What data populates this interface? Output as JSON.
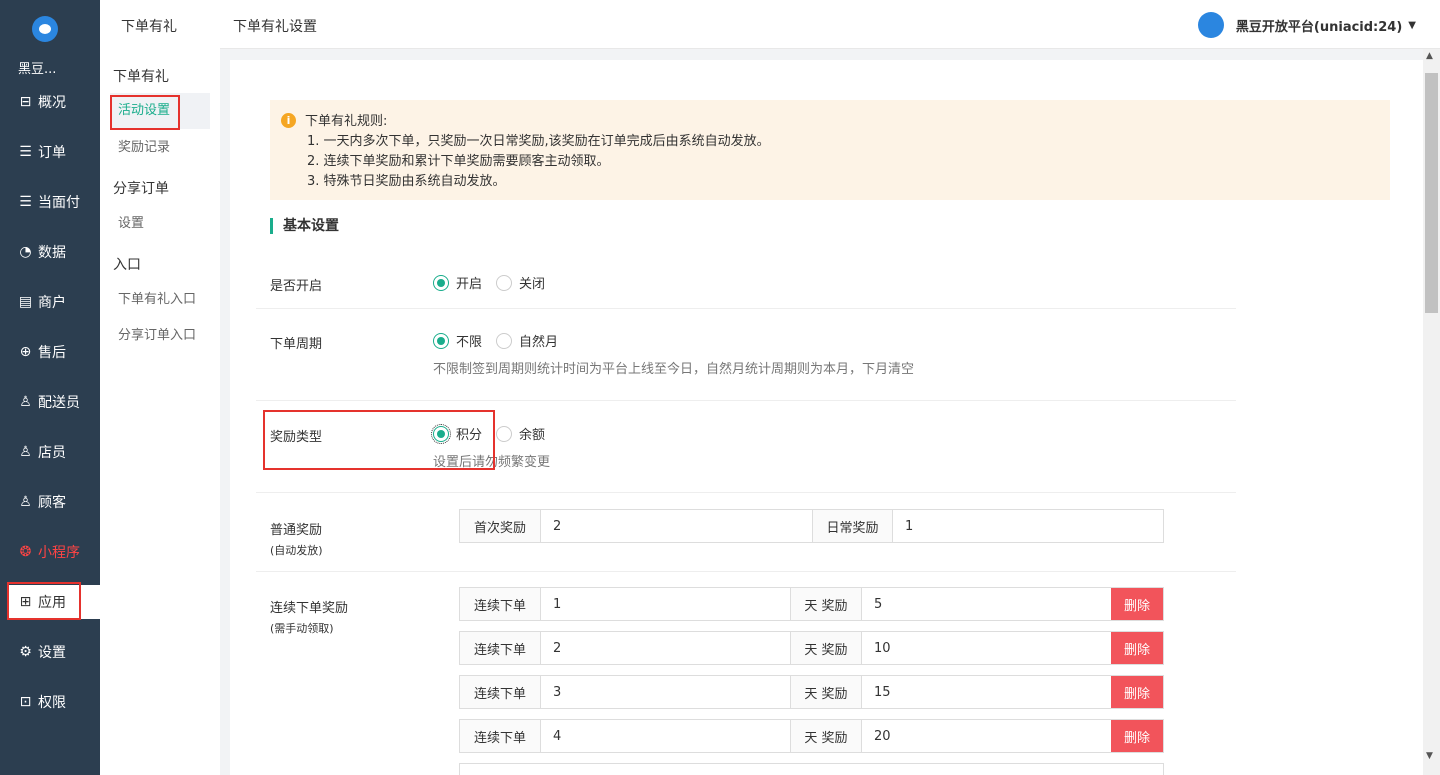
{
  "nav": {
    "brand": "黑豆...",
    "items": [
      {
        "label": "概况",
        "icon": "overview-icon"
      },
      {
        "label": "订单",
        "icon": "order-icon"
      },
      {
        "label": "当面付",
        "icon": "pay-icon"
      },
      {
        "label": "数据",
        "icon": "chart-icon"
      },
      {
        "label": "商户",
        "icon": "shop-icon"
      },
      {
        "label": "售后",
        "icon": "aftersale-icon"
      },
      {
        "label": "配送员",
        "icon": "courier-icon"
      },
      {
        "label": "店员",
        "icon": "staff-icon"
      },
      {
        "label": "顾客",
        "icon": "customer-icon"
      },
      {
        "label": "小程序",
        "icon": "miniprogram-icon"
      },
      {
        "label": "应用",
        "icon": "apps-icon"
      },
      {
        "label": "设置",
        "icon": "gear-icon"
      },
      {
        "label": "权限",
        "icon": "lock-icon"
      }
    ]
  },
  "sub": {
    "group1": "下单有礼",
    "item_active": "活动设置",
    "item2": "奖励记录",
    "group2": "分享订单",
    "item3": "设置",
    "group3": "入口",
    "item4": "下单有礼入口",
    "item5": "分享订单入口"
  },
  "topbar": {
    "section": "下单有礼",
    "title": "下单有礼设置",
    "user": "黑豆开放平台(uniacid:24)"
  },
  "notice": {
    "title": "下单有礼规则:",
    "rules": [
      "1. 一天内多次下单，只奖励一次日常奖励,该奖励在订单完成后由系统自动发放。",
      "2. 连续下单奖励和累计下单奖励需要顾客主动领取。",
      "3. 特殊节日奖励由系统自动发放。"
    ]
  },
  "section_title": "基本设置",
  "enable": {
    "label": "是否开启",
    "on": "开启",
    "off": "关闭"
  },
  "period": {
    "label": "下单周期",
    "opt1": "不限",
    "opt2": "自然月",
    "hint": "不限制签到周期则统计时间为平台上线至今日，自然月统计周期则为本月，下月清空"
  },
  "reward_type": {
    "label": "奖励类型",
    "opt1": "积分",
    "opt2": "余额",
    "hint": "设置后请勿频繁变更"
  },
  "normal": {
    "label": "普通奖励",
    "sub": "(自动发放)",
    "first_label": "首次奖励",
    "first_value": "2",
    "daily_label": "日常奖励",
    "daily_value": "1"
  },
  "consecutive": {
    "label": "连续下单奖励",
    "sub": "(需手动领取)",
    "prefix": "连续下单",
    "mid": "天 奖励",
    "delete": "删除",
    "rows": [
      {
        "days": "1",
        "reward": "5"
      },
      {
        "days": "2",
        "reward": "10"
      },
      {
        "days": "3",
        "reward": "15"
      },
      {
        "days": "4",
        "reward": "20"
      }
    ]
  }
}
